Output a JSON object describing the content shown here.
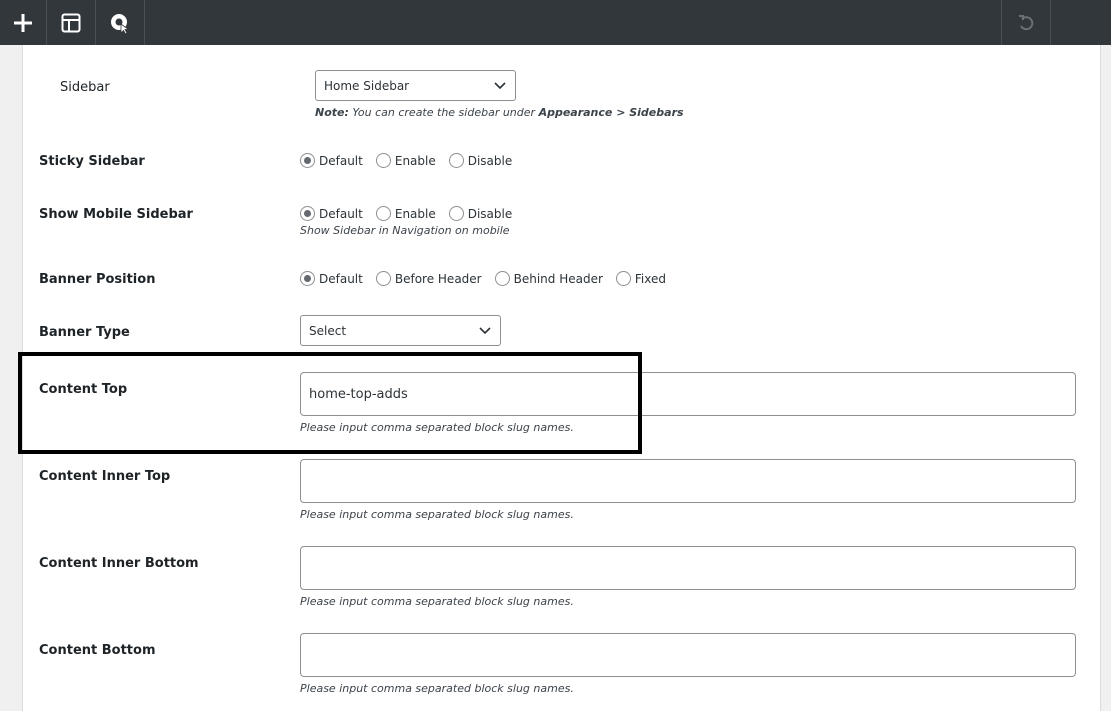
{
  "toolbar": {
    "add_icon": "plus-icon",
    "layout_icon": "layout-icon",
    "customize_icon": "customize-icon",
    "undo_icon": "undo-icon"
  },
  "fields": {
    "sidebar": {
      "label": "Sidebar",
      "value": "Home Sidebar",
      "note_prefix": "Note:",
      "note_text": " You can create the sidebar under ",
      "note_path": "Appearance > Sidebars"
    },
    "sticky_sidebar": {
      "label": "Sticky Sidebar",
      "options": [
        "Default",
        "Enable",
        "Disable"
      ],
      "selected": "Default"
    },
    "show_mobile_sidebar": {
      "label": "Show Mobile Sidebar",
      "options": [
        "Default",
        "Enable",
        "Disable"
      ],
      "selected": "Default",
      "help": "Show Sidebar in Navigation on mobile"
    },
    "banner_position": {
      "label": "Banner Position",
      "options": [
        "Default",
        "Before Header",
        "Behind Header",
        "Fixed"
      ],
      "selected": "Default"
    },
    "banner_type": {
      "label": "Banner Type",
      "value": "Select"
    },
    "content_top": {
      "label": "Content Top",
      "value": "home-top-adds",
      "help": "Please input comma separated block slug names."
    },
    "content_inner_top": {
      "label": "Content Inner Top",
      "value": "",
      "help": "Please input comma separated block slug names."
    },
    "content_inner_bottom": {
      "label": "Content Inner Bottom",
      "value": "",
      "help": "Please input comma separated block slug names."
    },
    "content_bottom": {
      "label": "Content Bottom",
      "value": "",
      "help": "Please input comma separated block slug names."
    }
  },
  "colors": {
    "toolbar_bg": "#32373c",
    "highlight_border": "#000000"
  }
}
